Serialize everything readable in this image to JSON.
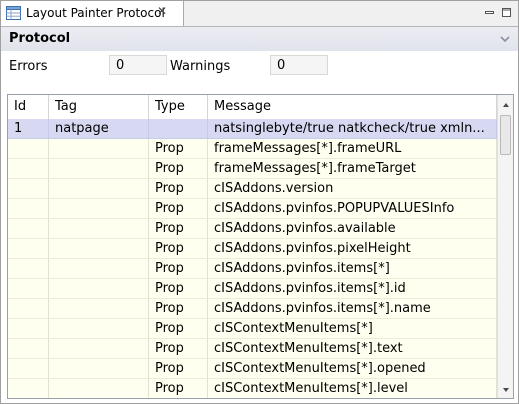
{
  "tab": {
    "title": "Layout Painter Protocol",
    "close_glyph": "✕",
    "icon": "table-view-icon"
  },
  "window_buttons": [
    "minimize-icon",
    "maximize-icon"
  ],
  "panel": {
    "title": "Protocol",
    "collapse_icon": "chevron-down-icon"
  },
  "counters": {
    "errors_label": "Errors",
    "errors_value": "0",
    "warnings_label": "Warnings",
    "warnings_value": "0"
  },
  "table": {
    "columns": [
      "Id",
      "Tag",
      "Type",
      "Message"
    ],
    "rows": [
      {
        "id": "1",
        "tag": "natpage",
        "type": "",
        "message": "natsinglebyte/true natkcheck/true xmln...",
        "selected": true
      },
      {
        "id": "",
        "tag": "",
        "type": "Prop",
        "message": "frameMessages[*].frameURL"
      },
      {
        "id": "",
        "tag": "",
        "type": "Prop",
        "message": "frameMessages[*].frameTarget"
      },
      {
        "id": "",
        "tag": "",
        "type": "Prop",
        "message": "cISAddons.version"
      },
      {
        "id": "",
        "tag": "",
        "type": "Prop",
        "message": "cISAddons.pvinfos.POPUPVALUESInfo"
      },
      {
        "id": "",
        "tag": "",
        "type": "Prop",
        "message": "cISAddons.pvinfos.available"
      },
      {
        "id": "",
        "tag": "",
        "type": "Prop",
        "message": "cISAddons.pvinfos.pixelHeight"
      },
      {
        "id": "",
        "tag": "",
        "type": "Prop",
        "message": "cISAddons.pvinfos.items[*]"
      },
      {
        "id": "",
        "tag": "",
        "type": "Prop",
        "message": "cISAddons.pvinfos.items[*].id"
      },
      {
        "id": "",
        "tag": "",
        "type": "Prop",
        "message": "cISAddons.pvinfos.items[*].name"
      },
      {
        "id": "",
        "tag": "",
        "type": "Prop",
        "message": "cISContextMenuItems[*]"
      },
      {
        "id": "",
        "tag": "",
        "type": "Prop",
        "message": "cISContextMenuItems[*].text"
      },
      {
        "id": "",
        "tag": "",
        "type": "Prop",
        "message": "cISContextMenuItems[*].opened"
      },
      {
        "id": "",
        "tag": "",
        "type": "Prop",
        "message": "cISContextMenuItems[*].level"
      }
    ]
  },
  "colors": {
    "row_background": "#fffff0",
    "selected_row": "#d7d9f2",
    "panel_header": "#e4e6ee"
  }
}
